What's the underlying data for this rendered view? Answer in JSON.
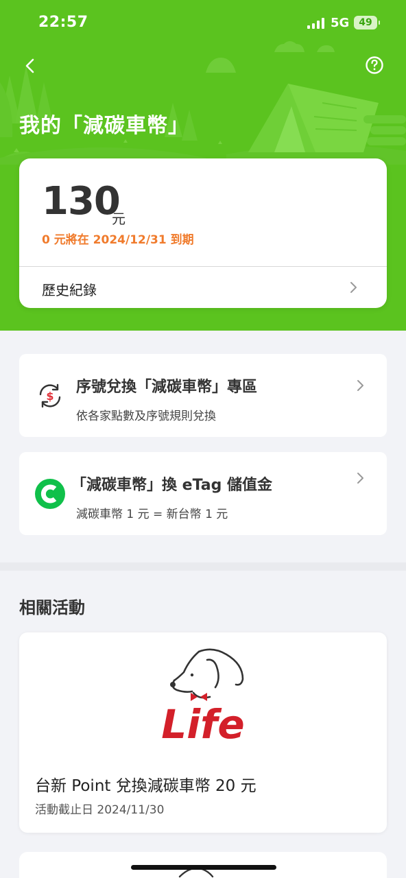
{
  "status_bar": {
    "time": "22:57",
    "network": "5G",
    "battery": "49"
  },
  "header": {
    "title": "我的「減碳車幣」"
  },
  "balance": {
    "amount": "130",
    "unit": "元",
    "expiry_note": "0 元將在 2024/12/31 到期",
    "history_label": "歷史紀錄"
  },
  "menu": [
    {
      "title": "序號兌換「減碳車幣」專區",
      "subtitle": "依各家點數及序號規則兌換",
      "icon": "dollar-exchange-icon"
    },
    {
      "title": "「減碳車幣」換 eTag 儲值金",
      "subtitle": "減碳車幣 1 元 = 新台幣 1 元",
      "icon": "etag-c-icon"
    }
  ],
  "activities": {
    "section_title": "相關活動",
    "items": [
      {
        "logo_text": "Life",
        "title": "台新 Point 兌換減碳車幣 20 元",
        "deadline": "活動截止日 2024/11/30"
      }
    ]
  },
  "colors": {
    "brand_green": "#5bc31f",
    "expiry_orange": "#f07b2c",
    "logo_red": "#d3202a"
  }
}
